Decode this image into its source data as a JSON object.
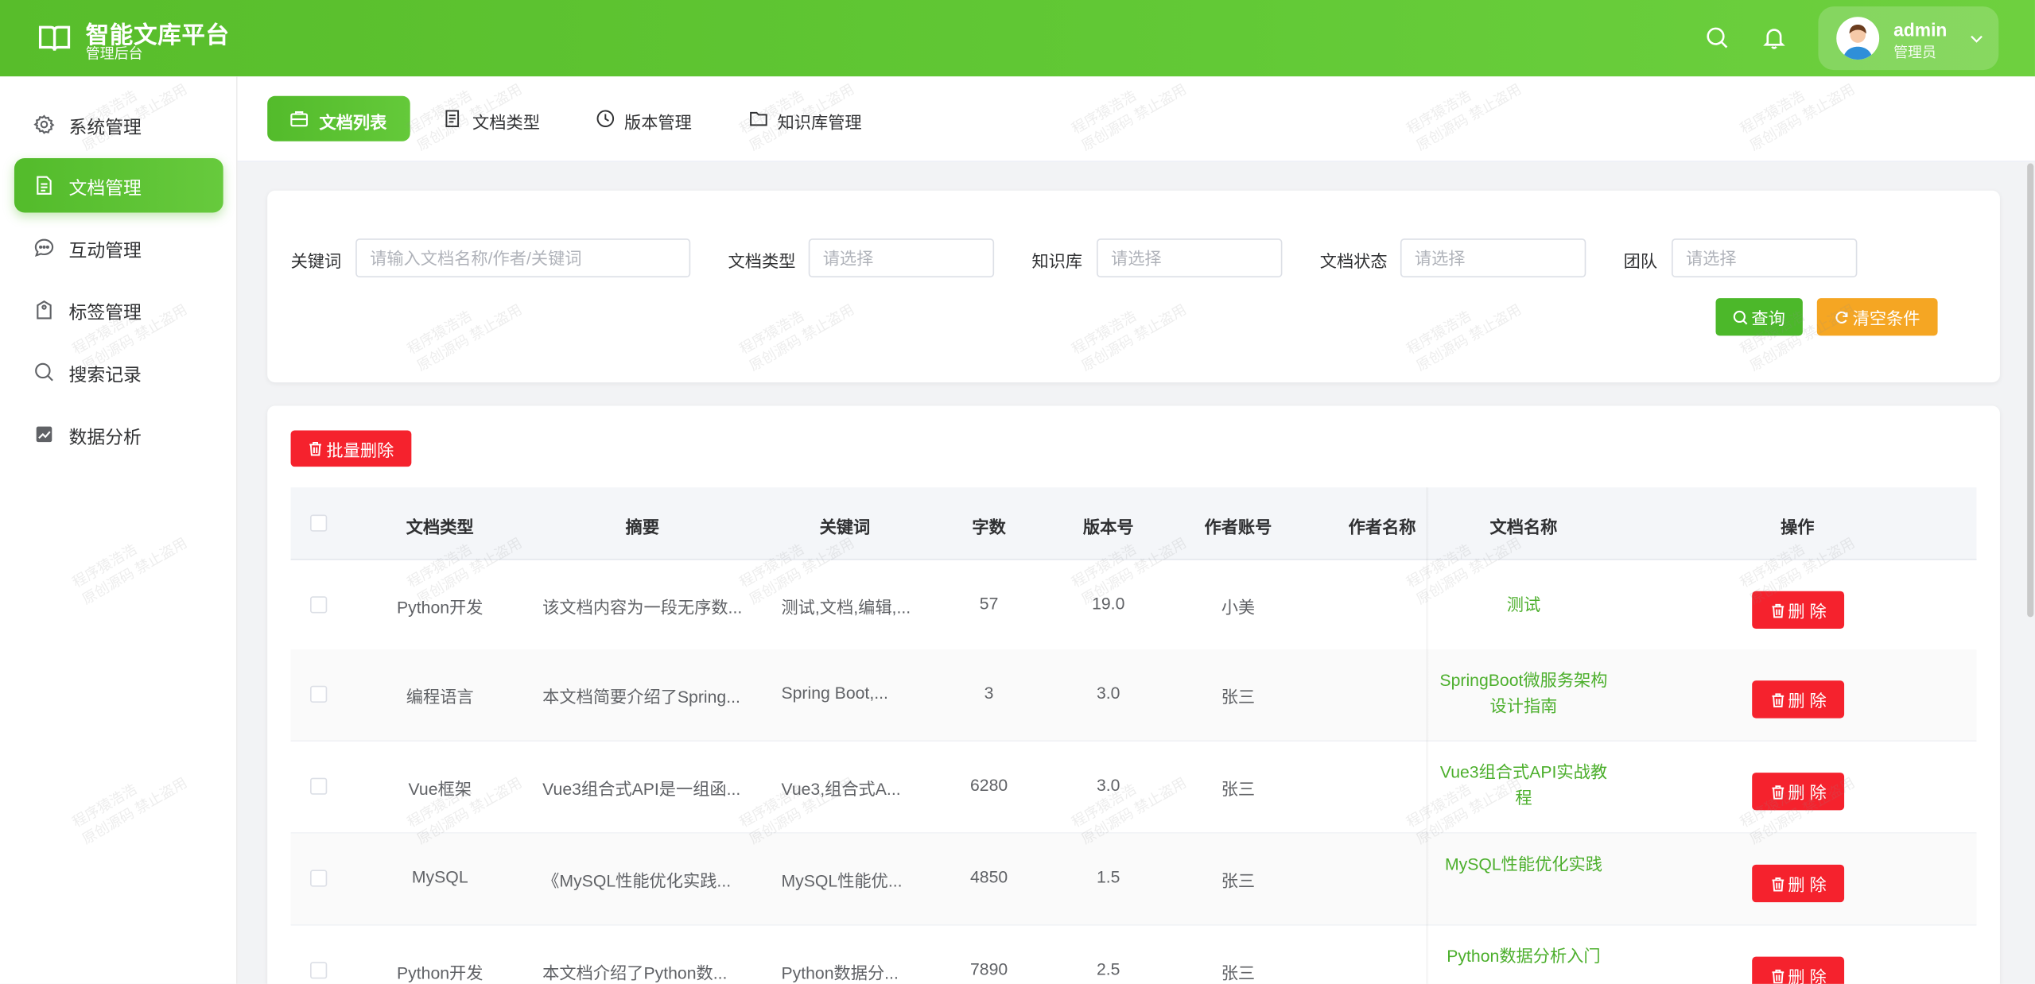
{
  "brand": {
    "title": "智能文库平台",
    "subtitle": "管理后台"
  },
  "user": {
    "name": "admin",
    "role": "管理员"
  },
  "sidebar": {
    "items": [
      {
        "label": "系统管理",
        "icon": "gear-icon"
      },
      {
        "label": "文档管理",
        "icon": "document-icon",
        "active": true
      },
      {
        "label": "互动管理",
        "icon": "chat-icon"
      },
      {
        "label": "标签管理",
        "icon": "tag-icon"
      },
      {
        "label": "搜索记录",
        "icon": "search-icon"
      },
      {
        "label": "数据分析",
        "icon": "chart-icon"
      }
    ]
  },
  "tabs": [
    {
      "label": "文档列表",
      "icon": "briefcase-icon",
      "active": true
    },
    {
      "label": "文档类型",
      "icon": "document-icon"
    },
    {
      "label": "版本管理",
      "icon": "clock-icon"
    },
    {
      "label": "知识库管理",
      "icon": "folder-icon"
    }
  ],
  "filters": {
    "keyword": {
      "label": "关键词",
      "placeholder": "请输入文档名称/作者/关键词"
    },
    "doc_type": {
      "label": "文档类型",
      "placeholder": "请选择"
    },
    "kb": {
      "label": "知识库",
      "placeholder": "请选择"
    },
    "status": {
      "label": "文档状态",
      "placeholder": "请选择"
    },
    "team": {
      "label": "团队",
      "placeholder": "请选择"
    },
    "search_label": "查询",
    "clear_label": "清空条件"
  },
  "toolbar": {
    "batch_delete_label": "批量删除"
  },
  "table": {
    "headers": [
      "文档类型",
      "摘要",
      "关键词",
      "字数",
      "版本号",
      "作者账号",
      "作者名称",
      "文档名称",
      "操作"
    ],
    "delete_label": "删 除",
    "rows": [
      {
        "type": "Python开发",
        "summary": "该文档内容为一段无序数...",
        "keywords": "测试,文档,编辑,...",
        "words": "57",
        "version": "19.0",
        "account": "小美",
        "author": "",
        "name": "测试"
      },
      {
        "type": "编程语言",
        "summary": "本文档简要介绍了Spring...",
        "keywords": "Spring Boot,...",
        "words": "3",
        "version": "3.0",
        "account": "张三",
        "author": "",
        "name": "SpringBoot微服务架构设计指南"
      },
      {
        "type": "Vue框架",
        "summary": "Vue3组合式API是一组函...",
        "keywords": "Vue3,组合式A...",
        "words": "6280",
        "version": "3.0",
        "account": "张三",
        "author": "",
        "name": "Vue3组合式API实战教程"
      },
      {
        "type": "MySQL",
        "summary": "《MySQL性能优化实践...",
        "keywords": "MySQL性能优...",
        "words": "4850",
        "version": "1.5",
        "account": "张三",
        "author": "",
        "name": "MySQL性能优化实践"
      },
      {
        "type": "Python开发",
        "summary": "本文档介绍了Python数...",
        "keywords": "Python数据分...",
        "words": "7890",
        "version": "2.5",
        "account": "张三",
        "author": "",
        "name": "Python数据分析入门"
      }
    ]
  },
  "watermark": {
    "line1": "程序猿浩浩",
    "line2": "原创源码 禁止盗用"
  },
  "colors": {
    "primary": "#5cc232",
    "danger": "#f5222d",
    "warning": "#f5a623",
    "link": "#4caf2c"
  }
}
